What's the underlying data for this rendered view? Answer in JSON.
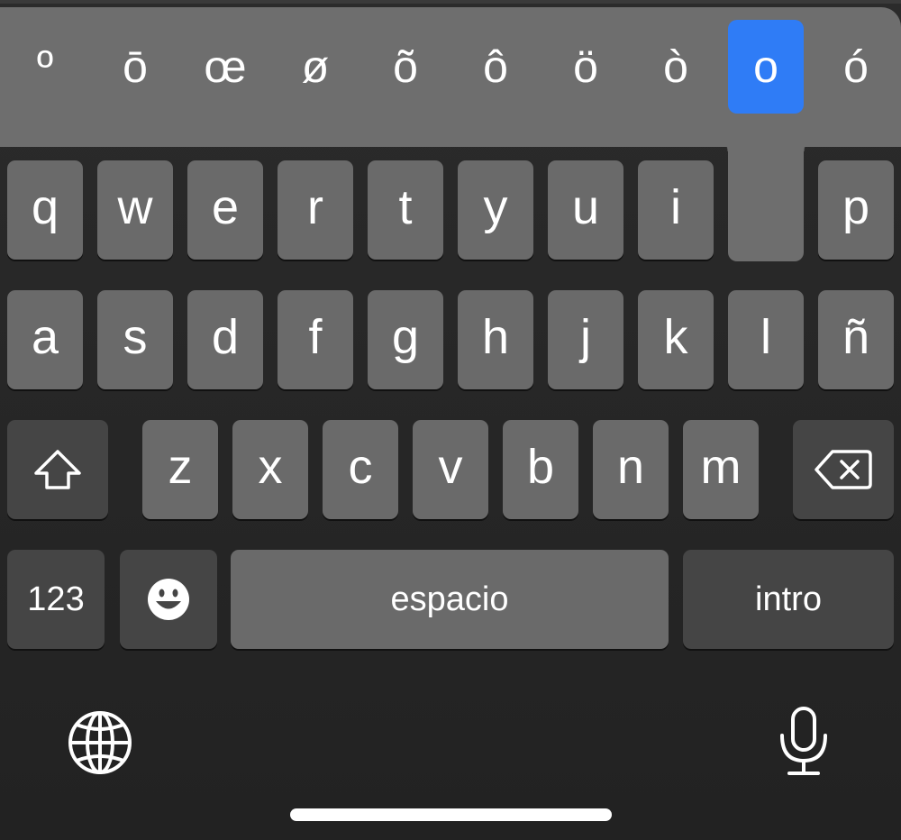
{
  "accent_popup": {
    "options": [
      "º",
      "ō",
      "œ",
      "ø",
      "õ",
      "ô",
      "ö",
      "ò",
      "o",
      "ó"
    ],
    "selected_index": 8,
    "selected_color": "#2f7cf6"
  },
  "row1": [
    "q",
    "w",
    "e",
    "r",
    "t",
    "y",
    "u",
    "i",
    "p"
  ],
  "row2": [
    "a",
    "s",
    "d",
    "f",
    "g",
    "h",
    "j",
    "k",
    "l",
    "ñ"
  ],
  "row3": [
    "z",
    "x",
    "c",
    "v",
    "b",
    "n",
    "m"
  ],
  "keys": {
    "numbers_label": "123",
    "space_label": "espacio",
    "return_label": "intro"
  },
  "icons": {
    "shift": "shift-icon",
    "delete": "delete-icon",
    "emoji": "emoji-icon",
    "globe": "globe-icon",
    "microphone": "microphone-icon"
  },
  "colors": {
    "key": "#6a6a6a",
    "function_key": "#454545",
    "background": "#232323"
  }
}
